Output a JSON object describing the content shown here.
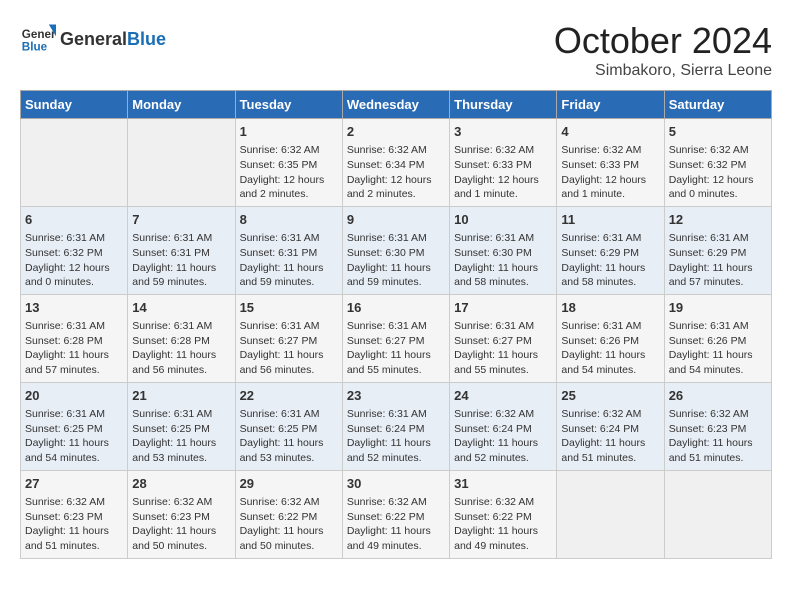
{
  "header": {
    "logo_general": "General",
    "logo_blue": "Blue",
    "month_title": "October 2024",
    "subtitle": "Simbakoro, Sierra Leone"
  },
  "days_of_week": [
    "Sunday",
    "Monday",
    "Tuesday",
    "Wednesday",
    "Thursday",
    "Friday",
    "Saturday"
  ],
  "weeks": [
    [
      {
        "day": "",
        "content": ""
      },
      {
        "day": "",
        "content": ""
      },
      {
        "day": "1",
        "content": "Sunrise: 6:32 AM\nSunset: 6:35 PM\nDaylight: 12 hours and 2 minutes."
      },
      {
        "day": "2",
        "content": "Sunrise: 6:32 AM\nSunset: 6:34 PM\nDaylight: 12 hours and 2 minutes."
      },
      {
        "day": "3",
        "content": "Sunrise: 6:32 AM\nSunset: 6:33 PM\nDaylight: 12 hours and 1 minute."
      },
      {
        "day": "4",
        "content": "Sunrise: 6:32 AM\nSunset: 6:33 PM\nDaylight: 12 hours and 1 minute."
      },
      {
        "day": "5",
        "content": "Sunrise: 6:32 AM\nSunset: 6:32 PM\nDaylight: 12 hours and 0 minutes."
      }
    ],
    [
      {
        "day": "6",
        "content": "Sunrise: 6:31 AM\nSunset: 6:32 PM\nDaylight: 12 hours and 0 minutes."
      },
      {
        "day": "7",
        "content": "Sunrise: 6:31 AM\nSunset: 6:31 PM\nDaylight: 11 hours and 59 minutes."
      },
      {
        "day": "8",
        "content": "Sunrise: 6:31 AM\nSunset: 6:31 PM\nDaylight: 11 hours and 59 minutes."
      },
      {
        "day": "9",
        "content": "Sunrise: 6:31 AM\nSunset: 6:30 PM\nDaylight: 11 hours and 59 minutes."
      },
      {
        "day": "10",
        "content": "Sunrise: 6:31 AM\nSunset: 6:30 PM\nDaylight: 11 hours and 58 minutes."
      },
      {
        "day": "11",
        "content": "Sunrise: 6:31 AM\nSunset: 6:29 PM\nDaylight: 11 hours and 58 minutes."
      },
      {
        "day": "12",
        "content": "Sunrise: 6:31 AM\nSunset: 6:29 PM\nDaylight: 11 hours and 57 minutes."
      }
    ],
    [
      {
        "day": "13",
        "content": "Sunrise: 6:31 AM\nSunset: 6:28 PM\nDaylight: 11 hours and 57 minutes."
      },
      {
        "day": "14",
        "content": "Sunrise: 6:31 AM\nSunset: 6:28 PM\nDaylight: 11 hours and 56 minutes."
      },
      {
        "day": "15",
        "content": "Sunrise: 6:31 AM\nSunset: 6:27 PM\nDaylight: 11 hours and 56 minutes."
      },
      {
        "day": "16",
        "content": "Sunrise: 6:31 AM\nSunset: 6:27 PM\nDaylight: 11 hours and 55 minutes."
      },
      {
        "day": "17",
        "content": "Sunrise: 6:31 AM\nSunset: 6:27 PM\nDaylight: 11 hours and 55 minutes."
      },
      {
        "day": "18",
        "content": "Sunrise: 6:31 AM\nSunset: 6:26 PM\nDaylight: 11 hours and 54 minutes."
      },
      {
        "day": "19",
        "content": "Sunrise: 6:31 AM\nSunset: 6:26 PM\nDaylight: 11 hours and 54 minutes."
      }
    ],
    [
      {
        "day": "20",
        "content": "Sunrise: 6:31 AM\nSunset: 6:25 PM\nDaylight: 11 hours and 54 minutes."
      },
      {
        "day": "21",
        "content": "Sunrise: 6:31 AM\nSunset: 6:25 PM\nDaylight: 11 hours and 53 minutes."
      },
      {
        "day": "22",
        "content": "Sunrise: 6:31 AM\nSunset: 6:25 PM\nDaylight: 11 hours and 53 minutes."
      },
      {
        "day": "23",
        "content": "Sunrise: 6:31 AM\nSunset: 6:24 PM\nDaylight: 11 hours and 52 minutes."
      },
      {
        "day": "24",
        "content": "Sunrise: 6:32 AM\nSunset: 6:24 PM\nDaylight: 11 hours and 52 minutes."
      },
      {
        "day": "25",
        "content": "Sunrise: 6:32 AM\nSunset: 6:24 PM\nDaylight: 11 hours and 51 minutes."
      },
      {
        "day": "26",
        "content": "Sunrise: 6:32 AM\nSunset: 6:23 PM\nDaylight: 11 hours and 51 minutes."
      }
    ],
    [
      {
        "day": "27",
        "content": "Sunrise: 6:32 AM\nSunset: 6:23 PM\nDaylight: 11 hours and 51 minutes."
      },
      {
        "day": "28",
        "content": "Sunrise: 6:32 AM\nSunset: 6:23 PM\nDaylight: 11 hours and 50 minutes."
      },
      {
        "day": "29",
        "content": "Sunrise: 6:32 AM\nSunset: 6:22 PM\nDaylight: 11 hours and 50 minutes."
      },
      {
        "day": "30",
        "content": "Sunrise: 6:32 AM\nSunset: 6:22 PM\nDaylight: 11 hours and 49 minutes."
      },
      {
        "day": "31",
        "content": "Sunrise: 6:32 AM\nSunset: 6:22 PM\nDaylight: 11 hours and 49 minutes."
      },
      {
        "day": "",
        "content": ""
      },
      {
        "day": "",
        "content": ""
      }
    ]
  ]
}
